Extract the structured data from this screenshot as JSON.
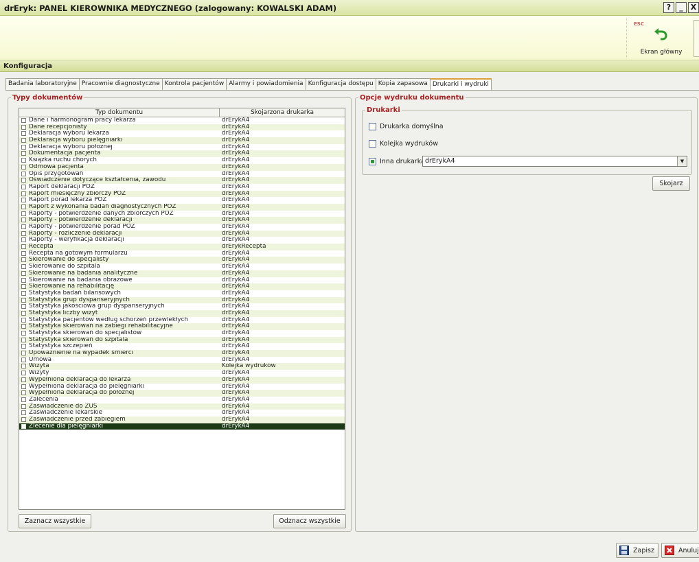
{
  "window": {
    "title": "drEryk: PANEL KIEROWNIKA MEDYCZNEGO (zalogowany: KOWALSKI ADAM)",
    "controls": [
      "?",
      "_",
      "X"
    ]
  },
  "toolbar": {
    "esc_label": "ESC",
    "home_label": "Ekran główny"
  },
  "section": {
    "title": "Konfiguracja"
  },
  "tabs": [
    {
      "label": "Badania laboratoryjne"
    },
    {
      "label": "Pracownie diagnostyczne"
    },
    {
      "label": "Kontrola pacjentów"
    },
    {
      "label": "Alarmy i powiadomienia"
    },
    {
      "label": "Konfiguracja dostępu"
    },
    {
      "label": "Kopia zapasowa"
    },
    {
      "label": "Drukarki i wydruki",
      "active": true
    }
  ],
  "left_panel": {
    "legend": "Typy dokumentów",
    "columns": [
      "Typ dokumentu",
      "Skojarzona drukarka"
    ],
    "rows": [
      [
        "Dane i harmonogram pracy lekarza",
        "drErykA4"
      ],
      [
        "Dane recepcjonisty",
        "drErykA4"
      ],
      [
        "Deklaracja wyboru lekarza",
        "drErykA4"
      ],
      [
        "Deklaracja wyboru pielęgniarki",
        "drErykA4"
      ],
      [
        "Deklaracja wyboru położnej",
        "drErykA4"
      ],
      [
        "Dokumentacja pacjenta",
        "drErykA4"
      ],
      [
        "Książka ruchu chorych",
        "drErykA4"
      ],
      [
        "Odmowa pacjenta",
        "drErykA4"
      ],
      [
        "Opis przygotowań",
        "drErykA4"
      ],
      [
        "Oświadczenie dotyczące kształcenia, zawodu",
        "drErykA4"
      ],
      [
        "Raport deklaracji POZ",
        "drErykA4"
      ],
      [
        "Raport miesięczny zbiorczy POZ",
        "drErykA4"
      ],
      [
        "Raport porad lekarza POZ",
        "drErykA4"
      ],
      [
        "Raport z wykonania badań diagnostycznych POZ",
        "drErykA4"
      ],
      [
        "Raporty - potwierdzenie danych zbiorczych POZ",
        "drErykA4"
      ],
      [
        "Raporty - potwierdzenie deklaracji",
        "drErykA4"
      ],
      [
        "Raporty - potwierdzenie porad POZ",
        "drErykA4"
      ],
      [
        "Raporty - rozliczenie deklaracji",
        "drErykA4"
      ],
      [
        "Raporty - weryfikacja deklaracji",
        "drErykA4"
      ],
      [
        "Recepta",
        "drErykRecepta"
      ],
      [
        "Recepta na gotowym formularzu",
        "drErykA4"
      ],
      [
        "Skierowanie do specjalisty",
        "drErykA4"
      ],
      [
        "Skierowanie do szpitala",
        "drErykA4"
      ],
      [
        "Skierowanie na badania analityczne",
        "drErykA4"
      ],
      [
        "Skierowanie na badania obrazowe",
        "drErykA4"
      ],
      [
        "Skierowanie na rehabilitację",
        "drErykA4"
      ],
      [
        "Statystyka badań bilansowych",
        "drErykA4"
      ],
      [
        "Statystyka grup dyspanseryjnych",
        "drErykA4"
      ],
      [
        "Statystyka jakościowa grup dyspanseryjnych",
        "drErykA4"
      ],
      [
        "Statystyka liczby wizyt",
        "drErykA4"
      ],
      [
        "Statystyka pacjentów według schorzeń przewlekłych",
        "drErykA4"
      ],
      [
        "Statystyka skierowań na zabiegi rehabilitacyjne",
        "drErykA4"
      ],
      [
        "Statystyka skierowań do specjalistów",
        "drErykA4"
      ],
      [
        "Statystyka skierowań do szpitala",
        "drErykA4"
      ],
      [
        "Statystyka szczepień",
        "drErykA4"
      ],
      [
        "Upoważnienie na wypadek śmierci",
        "drErykA4"
      ],
      [
        "Umowa",
        "drErykA4"
      ],
      [
        "Wizyta",
        "Kolejka wydruków"
      ],
      [
        "Wizyty",
        "drErykA4"
      ],
      [
        "Wypełniona deklaracja do lekarza",
        "drErykA4"
      ],
      [
        "Wypełniona deklaracja do pielęgniarki",
        "drErykA4"
      ],
      [
        "Wypełniona deklaracja do położnej",
        "drErykA4"
      ],
      [
        "Zalecenia",
        "drErykA4"
      ],
      [
        "Zaświadczenie do ZUS",
        "drErykA4"
      ],
      [
        "Zaświadczenie lekarskie",
        "drErykA4"
      ],
      [
        "Zaświadczenie przed zabiegiem",
        "drErykA4"
      ],
      [
        "Zlecenie dla pielęgniarki",
        "drErykA4"
      ]
    ],
    "selected_row_index": 46,
    "select_all_label": "Zaznacz wszystkie",
    "deselect_all_label": "Odznacz wszystkie"
  },
  "right_panel": {
    "legend": "Opcje wydruku dokumentu",
    "printers_legend": "Drukarki",
    "option_default": "Drukarka domyślna",
    "option_queue": "Kolejka wydruków",
    "option_other": "Inna drukarka",
    "other_printer_value": "drErykA4",
    "option_other_checked": true,
    "assign_label": "Skojarz"
  },
  "footer": {
    "save_label": "Zapisz",
    "cancel_label": "Anuluj"
  }
}
